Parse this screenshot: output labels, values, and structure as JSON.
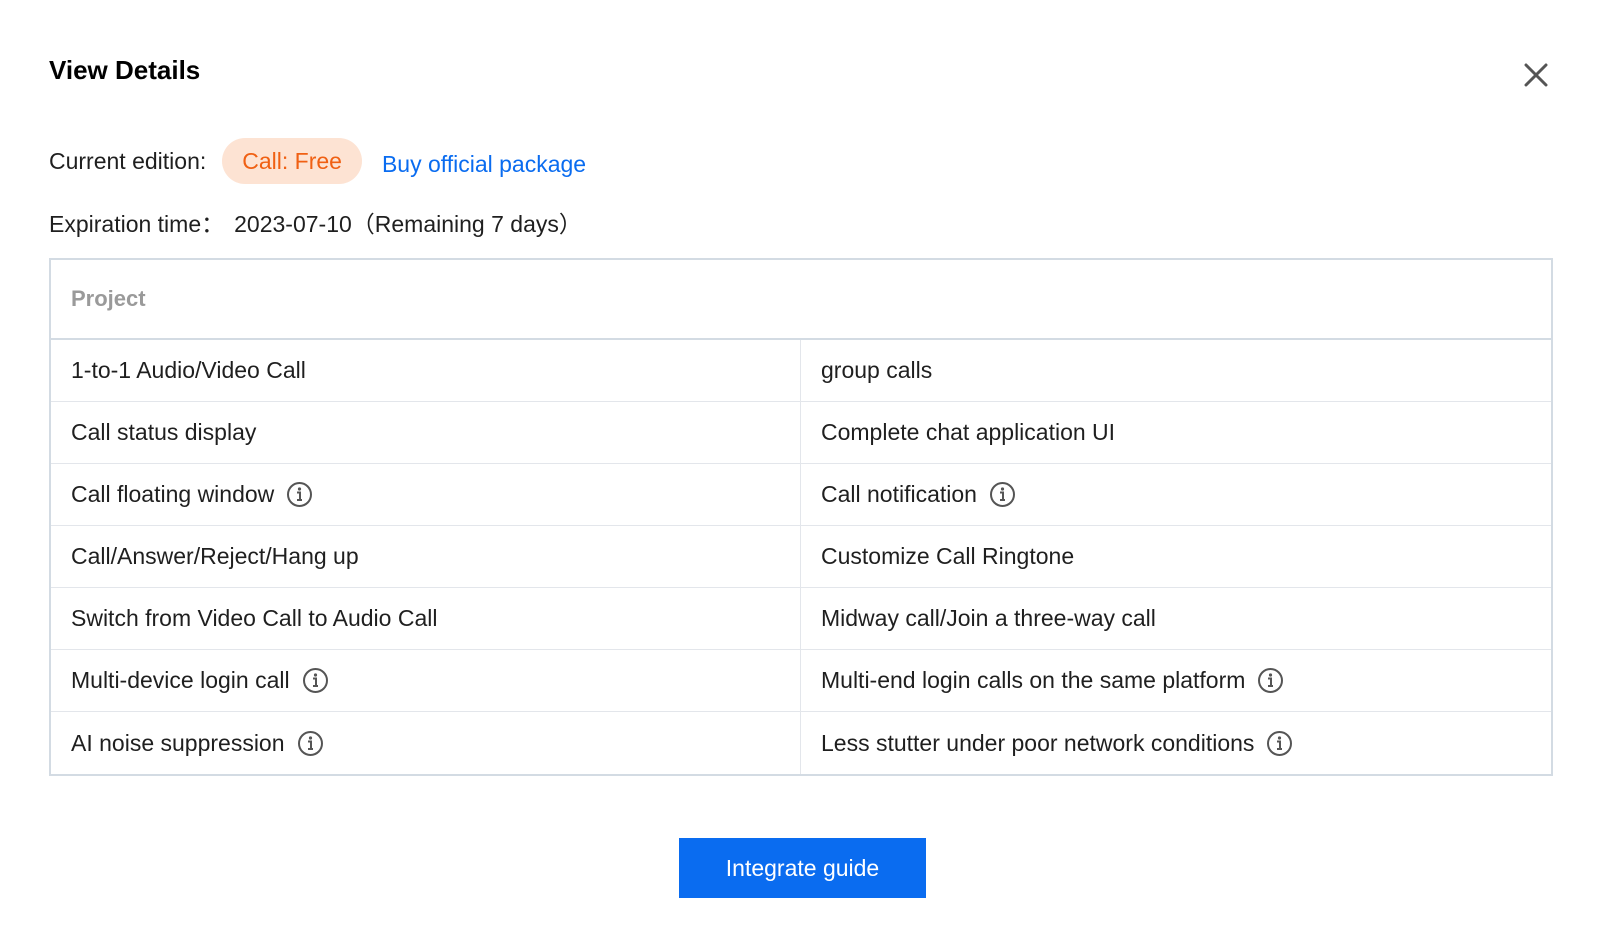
{
  "dialog": {
    "title": "View Details",
    "close_icon": "close-icon"
  },
  "edition": {
    "label": "Current edition:",
    "badge": "Call: Free",
    "buy_link": "Buy official package"
  },
  "expiration": {
    "label": "Expiration time：",
    "value": "2023-07-10（Remaining 7 days）"
  },
  "table": {
    "header": "Project",
    "rows": [
      [
        {
          "text": "1-to-1 Audio/Video Call",
          "info": false
        },
        {
          "text": "group calls",
          "info": false
        }
      ],
      [
        {
          "text": "Call status display",
          "info": false
        },
        {
          "text": "Complete chat application UI",
          "info": false
        }
      ],
      [
        {
          "text": "Call floating window",
          "info": true
        },
        {
          "text": "Call notification",
          "info": true
        }
      ],
      [
        {
          "text": "Call/Answer/Reject/Hang up",
          "info": false
        },
        {
          "text": "Customize Call Ringtone",
          "info": false
        }
      ],
      [
        {
          "text": "Switch from Video Call to Audio Call",
          "info": false
        },
        {
          "text": "Midway call/Join a three-way call",
          "info": false
        }
      ],
      [
        {
          "text": "Multi-device login call",
          "info": true
        },
        {
          "text": "Multi-end login calls on the same platform",
          "info": true
        }
      ],
      [
        {
          "text": "AI noise suppression",
          "info": true
        },
        {
          "text": "Less stutter under poor network conditions",
          "info": true
        }
      ]
    ]
  },
  "footer": {
    "button_label": "Integrate guide"
  },
  "colors": {
    "accent": "#0a6cf0",
    "badge_bg": "#fde3d3",
    "badge_text": "#f06013",
    "border": "#d3dbe3"
  }
}
